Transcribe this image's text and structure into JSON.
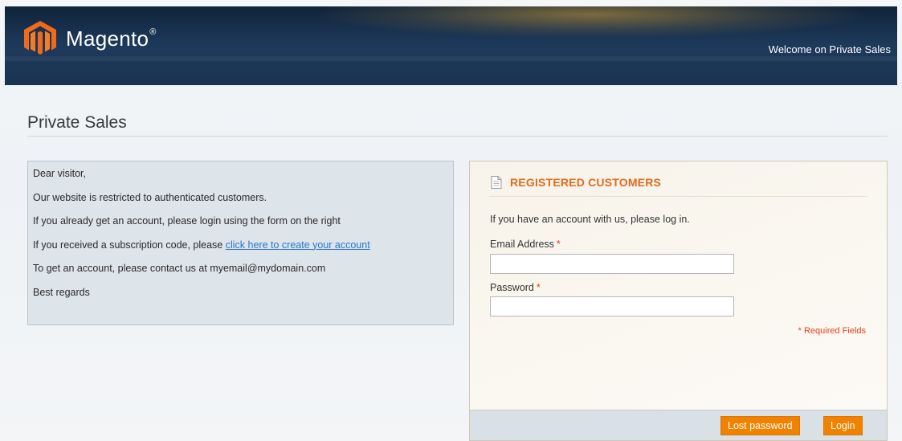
{
  "header": {
    "brand": "Magento",
    "brand_mark": "®",
    "welcome": "Welcome on Private Sales"
  },
  "page": {
    "title": "Private Sales"
  },
  "message": {
    "greeting": "Dear visitor,",
    "line1": "Our website is restricted to authenticated customers.",
    "line2": "If you already get an account, please login using the form on the right",
    "line3_prefix": "If you received a subscription code, please ",
    "line3_link": "click here to create your account",
    "line4": "To get an account, please contact us at myemail@mydomain.com",
    "closing": "Best regards"
  },
  "login": {
    "title": "REGISTERED CUSTOMERS",
    "intro": "If you have an account with us, please log in.",
    "email_label": "Email Address",
    "email_value": "",
    "password_label": "Password",
    "password_value": "",
    "required_mark": "*",
    "required_note": "* Required Fields",
    "lost_password_label": "Lost password",
    "login_label": "Login"
  },
  "icons": {
    "logo": "magento-logo-icon",
    "section": "document-icon"
  },
  "colors": {
    "accent": "#f18200",
    "title_orange": "#e26b1b",
    "required_red": "#e0421b",
    "header_navy": "#1b3352",
    "link_blue": "#2a78c4"
  }
}
